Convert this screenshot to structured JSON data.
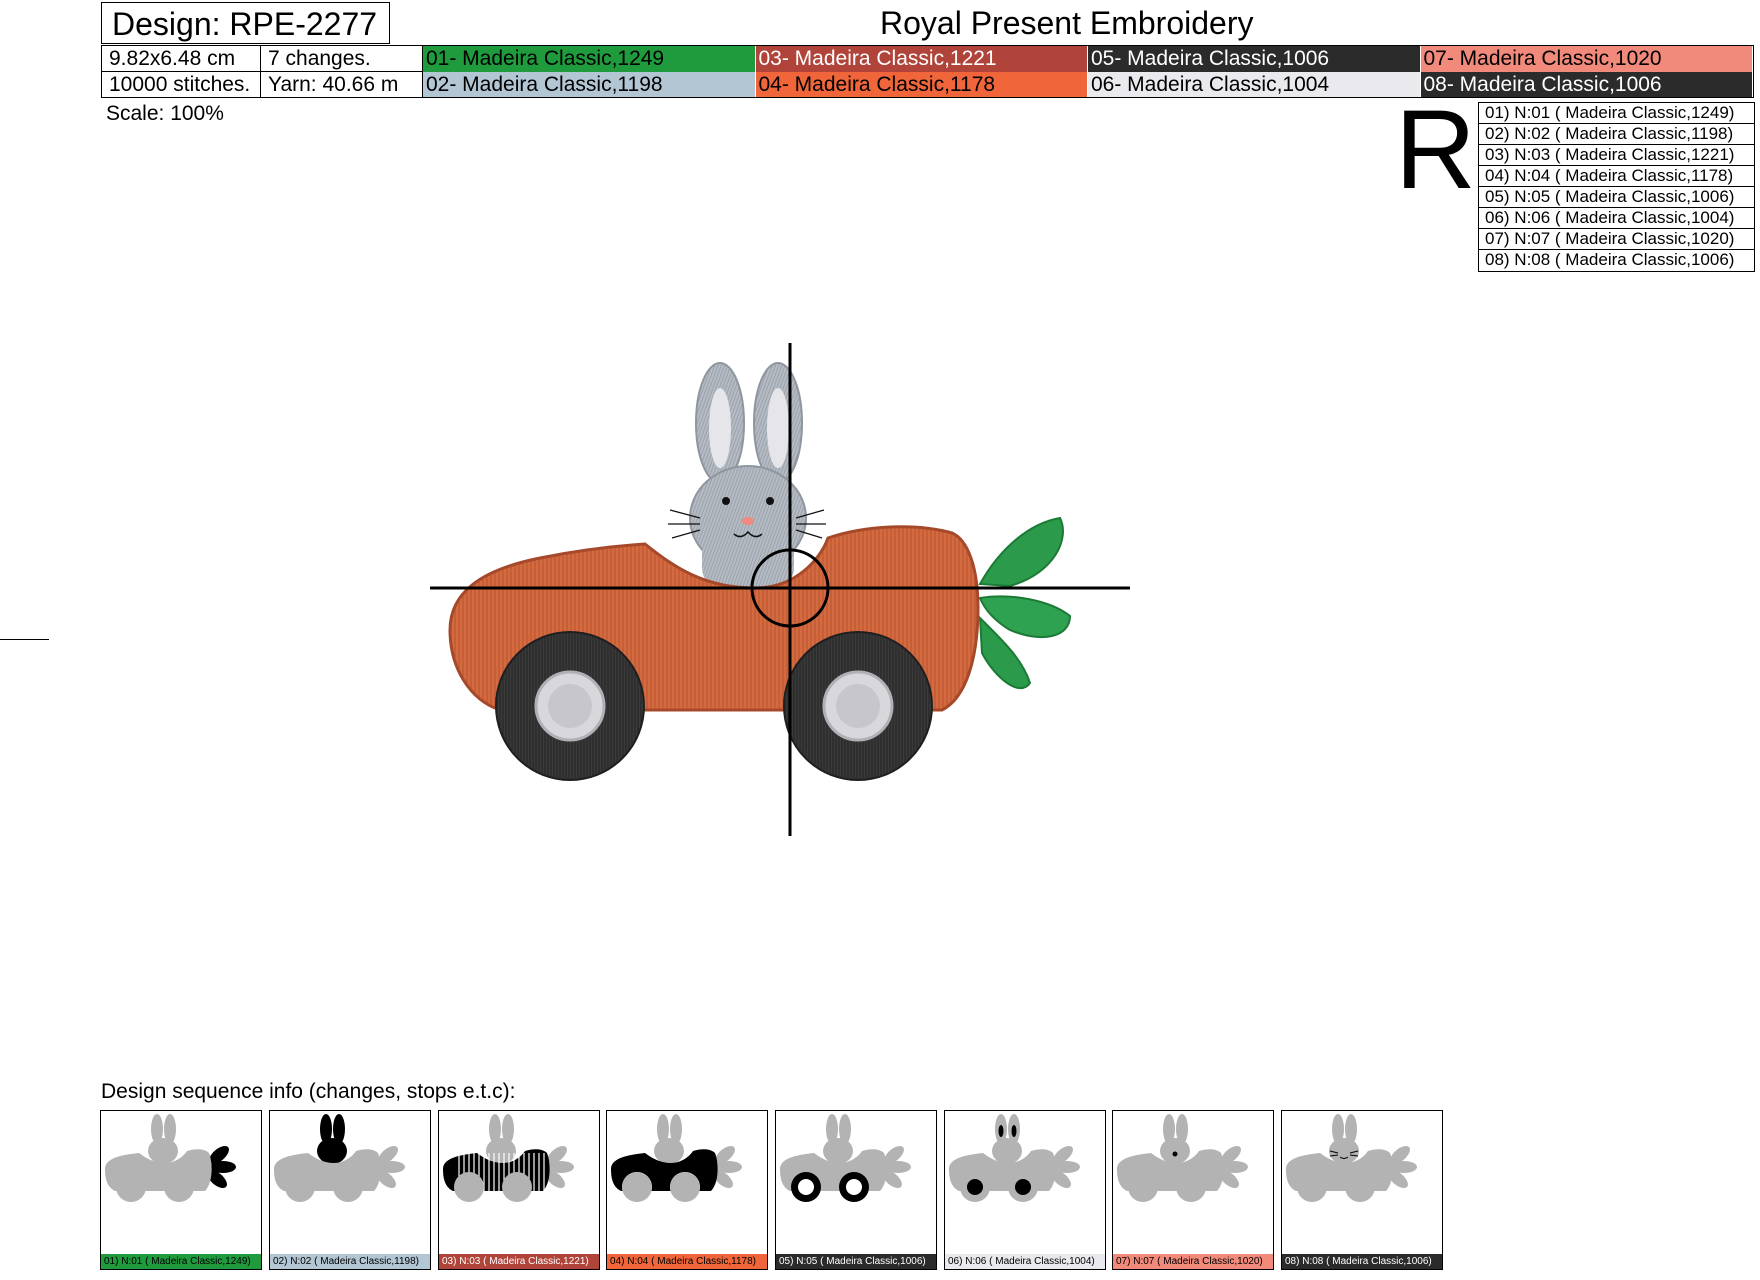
{
  "header": {
    "design_title": "Design: RPE-2277",
    "company": "Royal Present Embroidery",
    "size": "9.82x6.48 cm",
    "changes": "7 changes.",
    "stitches": "10000 stitches.",
    "yarn": "Yarn: 40.66 m",
    "scale": "Scale: 100%",
    "r_mark": "R"
  },
  "color_table": [
    {
      "label": "01- Madeira Classic,1249",
      "bg": "#1f9a3d",
      "fg": "#000000"
    },
    {
      "label": "03- Madeira Classic,1221",
      "bg": "#b0443a",
      "fg": "#ffffff"
    },
    {
      "label": "05- Madeira Classic,1006",
      "bg": "#2b2b2b",
      "fg": "#ffffff"
    },
    {
      "label": "07- Madeira Classic,1020",
      "bg": "#f28a7c",
      "fg": "#000000"
    },
    {
      "label": "02- Madeira Classic,1198",
      "bg": "#b3c6d3",
      "fg": "#000000"
    },
    {
      "label": "04- Madeira Classic,1178",
      "bg": "#f0663a",
      "fg": "#000000"
    },
    {
      "label": "06- Madeira Classic,1004",
      "bg": "#e9e9ee",
      "fg": "#000000"
    },
    {
      "label": "08- Madeira Classic,1006",
      "bg": "#2b2b2b",
      "fg": "#ffffff"
    }
  ],
  "legend": [
    "01) N:01 ( Madeira Classic,1249)",
    "02) N:02 ( Madeira Classic,1198)",
    "03) N:03 ( Madeira Classic,1221)",
    "04) N:04 ( Madeira Classic,1178)",
    "05) N:05 ( Madeira Classic,1006)",
    "06) N:06 ( Madeira Classic,1004)",
    "07) N:07 ( Madeira Classic,1020)",
    "08) N:08 ( Madeira Classic,1006)"
  ],
  "sequence": {
    "title": "Design sequence info (changes, stops e.t.c):",
    "steps": [
      {
        "label": "01) N:01 ( Madeira Classic,1249)",
        "bg": "#1f9a3d",
        "fg": "#000000",
        "part": "leaves"
      },
      {
        "label": "02) N:02 ( Madeira Classic,1198)",
        "bg": "#b3c6d3",
        "fg": "#000000",
        "part": "bunny"
      },
      {
        "label": "03) N:03 ( Madeira Classic,1221)",
        "bg": "#b0443a",
        "fg": "#ffffff",
        "part": "car-stripes"
      },
      {
        "label": "04) N:04 ( Madeira Classic,1178)",
        "bg": "#f0663a",
        "fg": "#000000",
        "part": "car-body"
      },
      {
        "label": "05) N:05 ( Madeira Classic,1006)",
        "bg": "#2b2b2b",
        "fg": "#ffffff",
        "part": "tires"
      },
      {
        "label": "06) N:06 ( Madeira Classic,1004)",
        "bg": "#e9e9ee",
        "fg": "#000000",
        "part": "hubs-ears"
      },
      {
        "label": "07) N:07 ( Madeira Classic,1020)",
        "bg": "#f28a7c",
        "fg": "#000000",
        "part": "nose"
      },
      {
        "label": "08) N:08 ( Madeira Classic,1006)",
        "bg": "#2b2b2b",
        "fg": "#ffffff",
        "part": "whiskers"
      }
    ]
  }
}
